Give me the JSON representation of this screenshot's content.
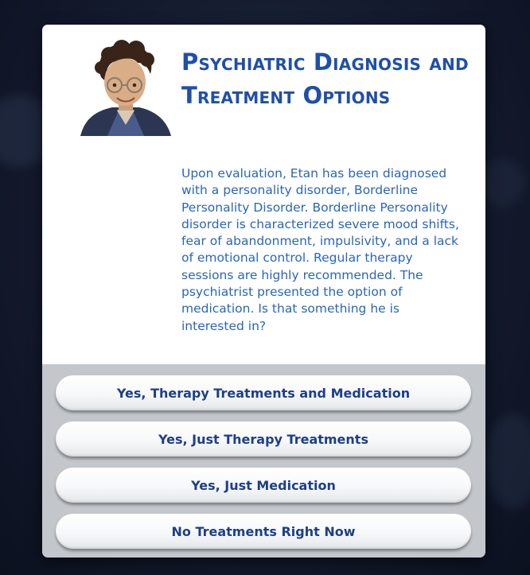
{
  "dialog": {
    "title": "Psychiatric Diagnosis and Treatment Options",
    "body": "Upon evaluation, Etan has been diagnosed with a personality disorder, Borderline Personality Disorder. Borderline Personality disorder is characterized severe mood shifts, fear of abandonment, impulsivity, and a lack of emotional control. Regular therapy sessions are highly recommended. The psychiatrist presented the option of medication. Is that something he is interested in?",
    "portrait_icon": "sim-portrait",
    "options": [
      {
        "label": "Yes, Therapy Treatments and Medication"
      },
      {
        "label": "Yes, Just Therapy Treatments"
      },
      {
        "label": "Yes, Just Medication"
      },
      {
        "label": "No Treatments Right Now"
      }
    ]
  },
  "colors": {
    "title": "#1f4fa8",
    "body_text": "#2a66b8",
    "button_text": "#1d3f86",
    "options_panel": "#c3c7cc",
    "background": "#141b2e"
  }
}
